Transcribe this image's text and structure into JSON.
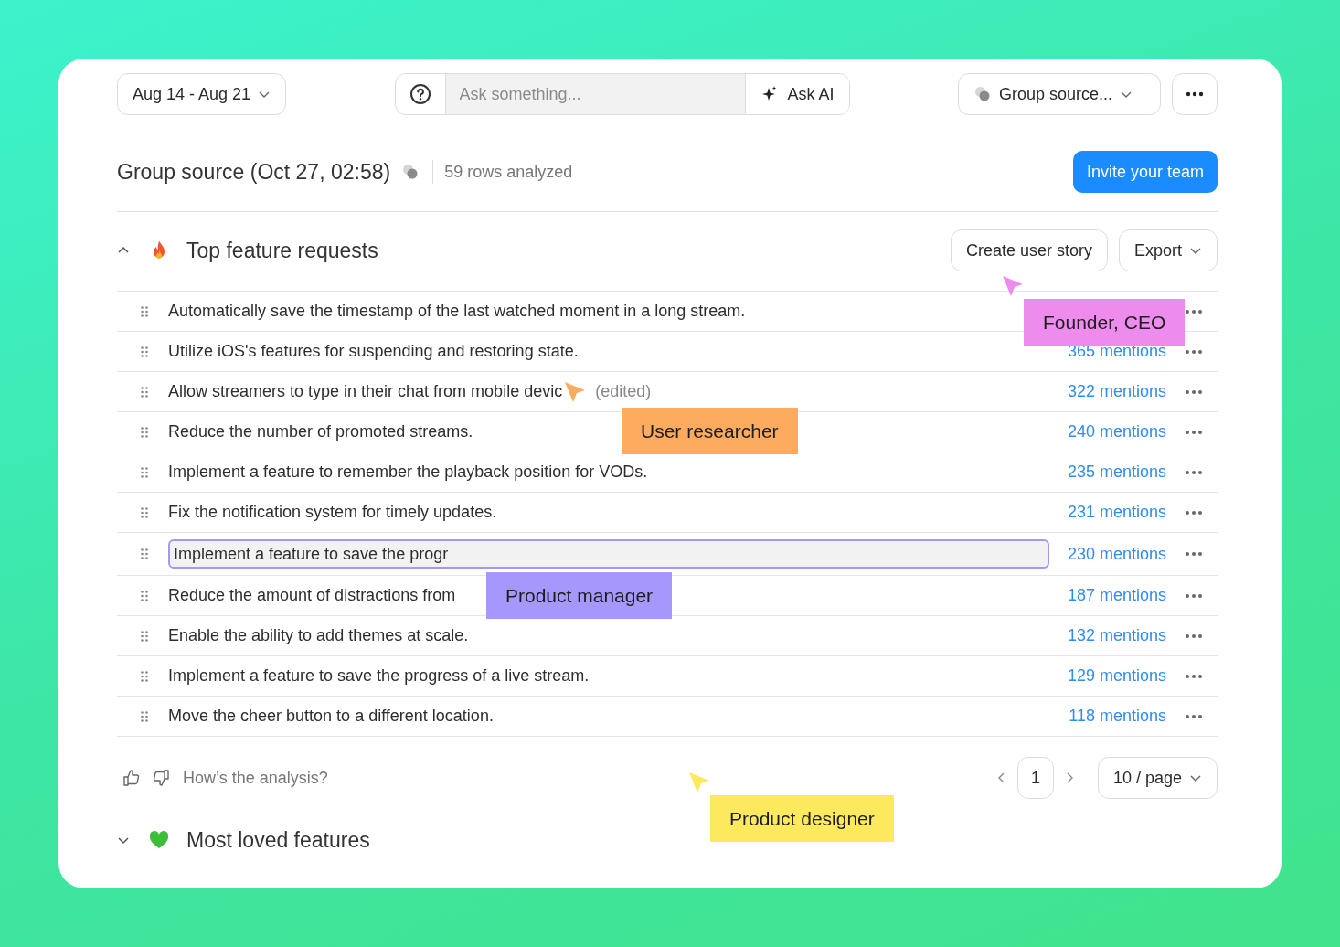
{
  "toolbar": {
    "date_range": "Aug 14 - Aug 21",
    "ask": {
      "placeholder": "Ask something...",
      "button": "Ask AI"
    },
    "group_select": "Group source..."
  },
  "header": {
    "title": "Group source (Oct 27, 02:58)",
    "rows_info": "59 rows analyzed",
    "invite": "Invite your team"
  },
  "sections": [
    {
      "title": "Top feature requests",
      "kind": "flame",
      "expanded": true,
      "actions": [
        "Create user story",
        "Export"
      ],
      "rows": [
        {
          "kind": "text",
          "text": "Automatically save the timestamp of the last watched moment in a long stream."
        },
        {
          "kind": "text",
          "text": "Utilize iOS's features for suspending and restoring state.",
          "mentions": "365 mentions"
        },
        {
          "kind": "text",
          "text": "Allow streamers to type in their chat from mobile devic",
          "note": "(edited)",
          "mentions": "322 mentions"
        },
        {
          "kind": "text",
          "text": "Reduce the number of promoted streams.",
          "mentions": "240 mentions"
        },
        {
          "kind": "text",
          "text": "Implement a feature to remember the playback position for VODs.",
          "mentions": "235 mentions"
        },
        {
          "kind": "text",
          "text": "Fix the notification system for timely updates.",
          "mentions": "231 mentions"
        },
        {
          "kind": "input",
          "text": "Implement a feature to save the progr",
          "mentions": "230 mentions"
        },
        {
          "kind": "text",
          "text": "Reduce the amount of distractions from",
          "mentions": "187 mentions"
        },
        {
          "kind": "text",
          "text": "Enable the ability to add themes at scale.",
          "mentions": "132 mentions"
        },
        {
          "kind": "text",
          "text": "Implement a feature to save the progress of a live stream.",
          "mentions": "129 mentions"
        },
        {
          "kind": "text",
          "text": "Move the cheer button to a different location.",
          "mentions": "118 mentions"
        }
      ],
      "feedback": "How’s the analysis?",
      "pagination": {
        "page": "1",
        "page_size": "10 / page"
      }
    },
    {
      "title": "Most loved features",
      "kind": "heart",
      "expanded": false
    }
  ],
  "cursors": [
    {
      "name": "Founder, CEO",
      "color": "#ee8cee",
      "arrow": true
    },
    {
      "name": "User researcher",
      "color": "#fdab5e",
      "arrow": true
    },
    {
      "name": "Product manager",
      "color": "#a597fb",
      "arrow": false
    },
    {
      "name": "Product designer",
      "color": "#fde95e",
      "arrow": true
    }
  ]
}
